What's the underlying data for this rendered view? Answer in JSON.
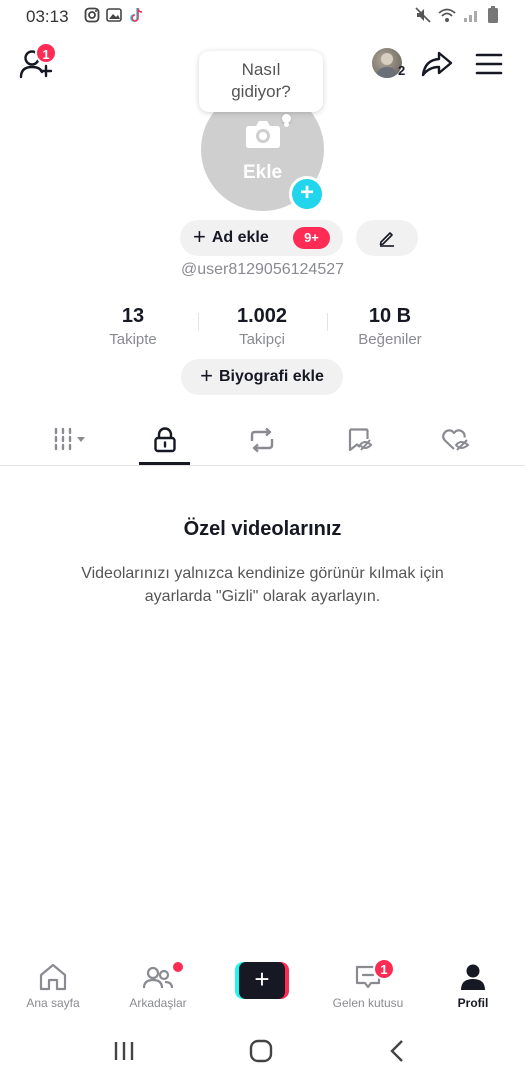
{
  "status_bar": {
    "time": "03:13"
  },
  "header": {
    "add_friend_badge": "1",
    "avatar_count": "2"
  },
  "profile": {
    "tooltip_line1": "Nasıl",
    "tooltip_line2": "gidiyor?",
    "avatar_label": "Ekle",
    "add_name_label": "Ad ekle",
    "notification_badge": "9+",
    "username": "@user8129056124527",
    "stats": [
      {
        "value": "13",
        "label": "Takipte"
      },
      {
        "value": "1.002",
        "label": "Takipçi"
      },
      {
        "value": "10 B",
        "label": "Beğeniler"
      }
    ],
    "bio_label": "Biyografi ekle"
  },
  "tabs": {
    "active": "private-videos",
    "items": [
      "videos",
      "private-videos",
      "reposts",
      "favorites",
      "liked"
    ]
  },
  "empty_state": {
    "title": "Özel videolarınız",
    "description_line1": "Videolarınızı yalnızca kendinize görünür kılmak için",
    "description_line2": "ayarlarda \"Gizli\" olarak ayarlayın."
  },
  "bottom_nav": {
    "home": "Ana sayfa",
    "friends": "Arkadaşlar",
    "inbox": "Gelen kutusu",
    "inbox_badge": "1",
    "profile": "Profil"
  },
  "colors": {
    "accent_red": "#fe2c55",
    "accent_cyan": "#20d5ec",
    "text_primary": "#161823",
    "text_secondary": "#8a8b91"
  }
}
